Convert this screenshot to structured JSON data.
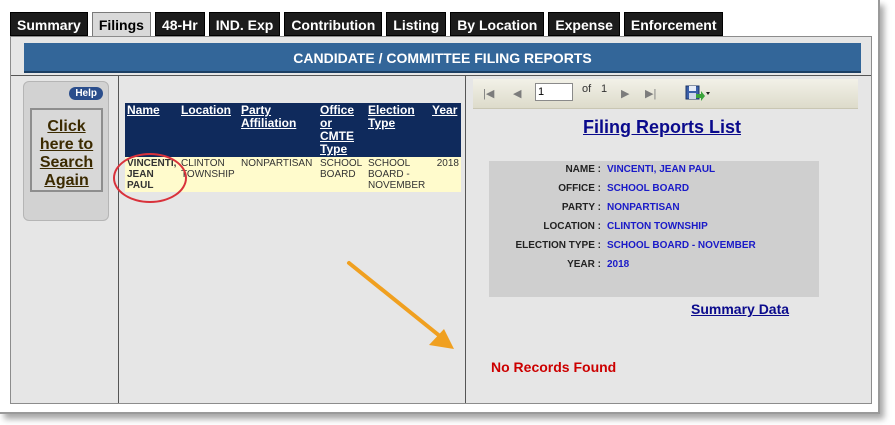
{
  "tabs": [
    {
      "label": "Summary",
      "active": false
    },
    {
      "label": "Filings",
      "active": true
    },
    {
      "label": "48-Hr",
      "active": false
    },
    {
      "label": "IND. Exp",
      "active": false
    },
    {
      "label": "Contribution",
      "active": false
    },
    {
      "label": "Listing",
      "active": false
    },
    {
      "label": "By Location",
      "active": false
    },
    {
      "label": "Expense",
      "active": false
    },
    {
      "label": "Enforcement",
      "active": false
    }
  ],
  "banner": "CANDIDATE / COMMITTEE FILING REPORTS",
  "search": {
    "help_label": "Help",
    "button_label": "Click here to Search Again"
  },
  "results": {
    "headers": [
      "Name",
      "Location",
      "Party Affiliation",
      "Office or CMTE Type",
      "Election Type",
      "Year"
    ],
    "rows": [
      [
        "VINCENTI, JEAN PAUL",
        "CLINTON TOWNSHIP",
        "NONPARTISAN",
        "SCHOOL BOARD",
        "SCHOOL BOARD - NOVEMBER",
        "2018"
      ]
    ]
  },
  "toolbar": {
    "page_value": "1",
    "of_label": "of",
    "total_pages": "1"
  },
  "report": {
    "title": "Filing Reports List",
    "fields": [
      {
        "label": "NAME :",
        "value": "VINCENTI, JEAN PAUL"
      },
      {
        "label": "OFFICE :",
        "value": "SCHOOL BOARD"
      },
      {
        "label": "PARTY :",
        "value": "NONPARTISAN"
      },
      {
        "label": "LOCATION :",
        "value": "CLINTON TOWNSHIP"
      },
      {
        "label": "ELECTION TYPE :",
        "value": "SCHOOL BOARD - NOVEMBER"
      },
      {
        "label": "YEAR :",
        "value": "2018"
      }
    ],
    "summary_link": "Summary Data",
    "no_records": "No Records Found"
  },
  "colors": {
    "banner": "#336699",
    "header": "#0f2a5c",
    "row": "#fffbcc",
    "annotation": "#d9323b",
    "arrow": "#f0a020",
    "norecords": "#cc0000"
  }
}
